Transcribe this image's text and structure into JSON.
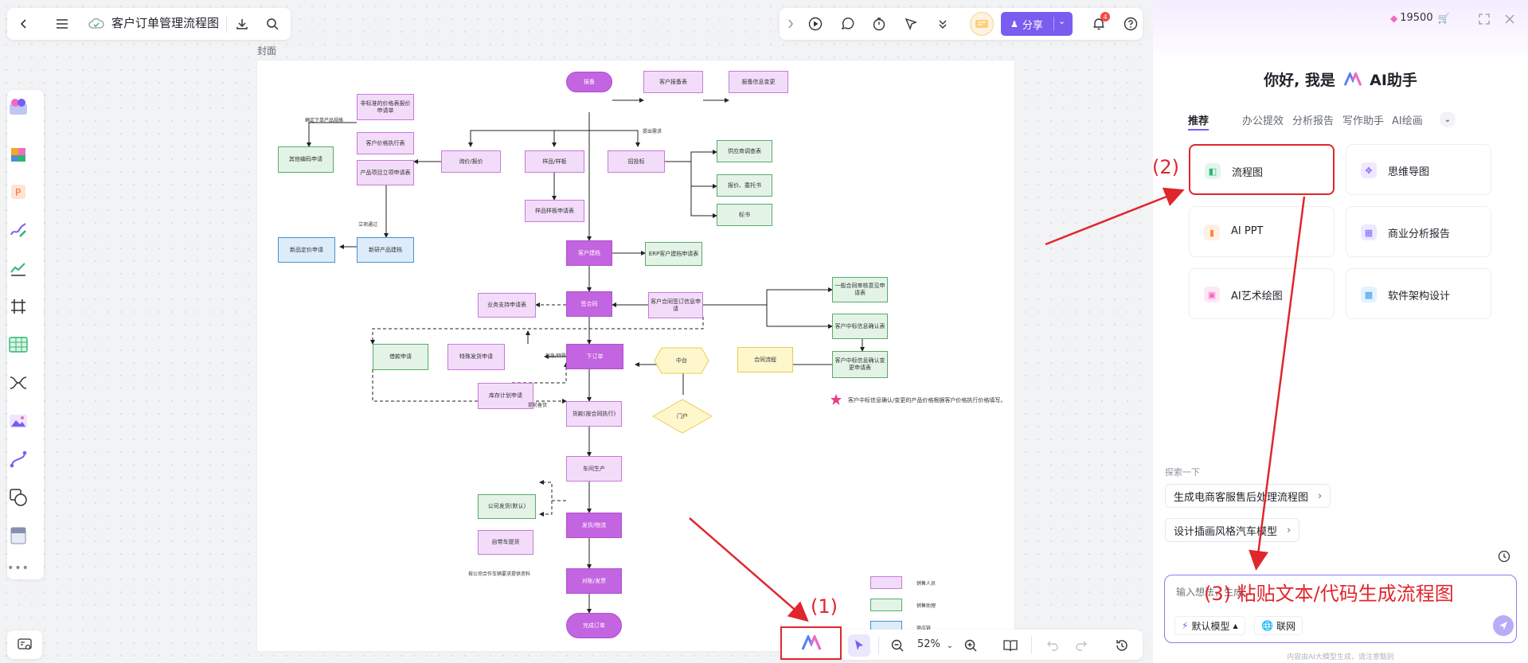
{
  "top_bar": {
    "title": "客户订单管理流程图"
  },
  "share": {
    "label": "分享"
  },
  "notifications": {
    "count": "4"
  },
  "paper": {
    "label": "封面"
  },
  "flowchart": {
    "nodes": {
      "n1": "报备",
      "n2": "客户报备表",
      "n3": "报备信息变更",
      "n4": "非标准的价格表报价申请单",
      "n5": "客户价格执行表",
      "n6": "产品项目立项申请表",
      "n7": "询价/报价",
      "n8": "样品/样板",
      "n9": "招投标",
      "n10": "样品样板申请表",
      "n11": "供应商调查表",
      "n12": "报价、委托书",
      "n13": "标书",
      "n14": "其他编码申请",
      "n15": "新品定价申请",
      "n16": "新研产品建档",
      "n17": "客户建档",
      "n18": "ERP客户建档申请表",
      "n19": "业务支持申请表",
      "n20": "签合同",
      "n21": "客户合同签订信息申请",
      "n22": "一般合同审核意见申请表",
      "n23": "客户中标信息确认表",
      "n24": "客户中标信息确认变更申请表",
      "n25": "借款申请",
      "n26": "特殊发货申请",
      "n27": "下订单",
      "n28": "中台",
      "n29": "合同流程",
      "n30": "库存计划申请",
      "n31": "货款(按合同执行)",
      "n32": "门户",
      "n33": "车间生产",
      "n34": "公司发货(默认)",
      "n35": "自带车提货",
      "n36": "发货/物流",
      "n37": "对账/发票",
      "n38": "完成订单"
    },
    "labels": {
      "l1": "确定下单产品规格",
      "l2": "立项通过",
      "l3": "提出需求",
      "l4": "加急/特殊",
      "l5": "提前备货",
      "l6": "按公司合作车辆要求提供资料"
    },
    "note": "客户中标信息确认/变更的产品价格根据客户价格执行价格填写。",
    "legend": [
      "销售人员",
      "销售助理",
      "供应链"
    ]
  },
  "bottom_toolbar": {
    "zoom": "52%"
  },
  "annotations": {
    "step1": "(1)",
    "step2": "(2)",
    "step3": "(3) 粘贴文本/代码生成流程图"
  },
  "panel": {
    "credits": "19500",
    "greeting_prefix": "你好, 我是",
    "greeting_name": "AI助手",
    "tabs": [
      "推荐",
      "办公提效",
      "分析报告",
      "写作助手",
      "AI绘画"
    ],
    "features": [
      {
        "label": "流程图",
        "icon": "flowchart-icon",
        "color": "#2bb673"
      },
      {
        "label": "思维导图",
        "icon": "mindmap-icon",
        "color": "#8a63f5"
      },
      {
        "label": "AI PPT",
        "icon": "ppt-icon",
        "color": "#ff8a3d"
      },
      {
        "label": "商业分析报告",
        "icon": "grid-icon",
        "color": "#7a6cf0"
      },
      {
        "label": "AI艺术绘图",
        "icon": "image-icon",
        "color": "#f06ac2"
      },
      {
        "label": "软件架构设计",
        "icon": "architecture-icon",
        "color": "#3aa0f0"
      }
    ],
    "explore_label": "探索一下",
    "suggestions": [
      "生成电商客服售后处理流程图",
      "设计插画风格汽车模型"
    ],
    "input_placeholder": "输入想法，生成...",
    "model_label": "默认模型",
    "web_label": "联网",
    "footer": "内容由AI大模型生成，请注意甄别"
  }
}
